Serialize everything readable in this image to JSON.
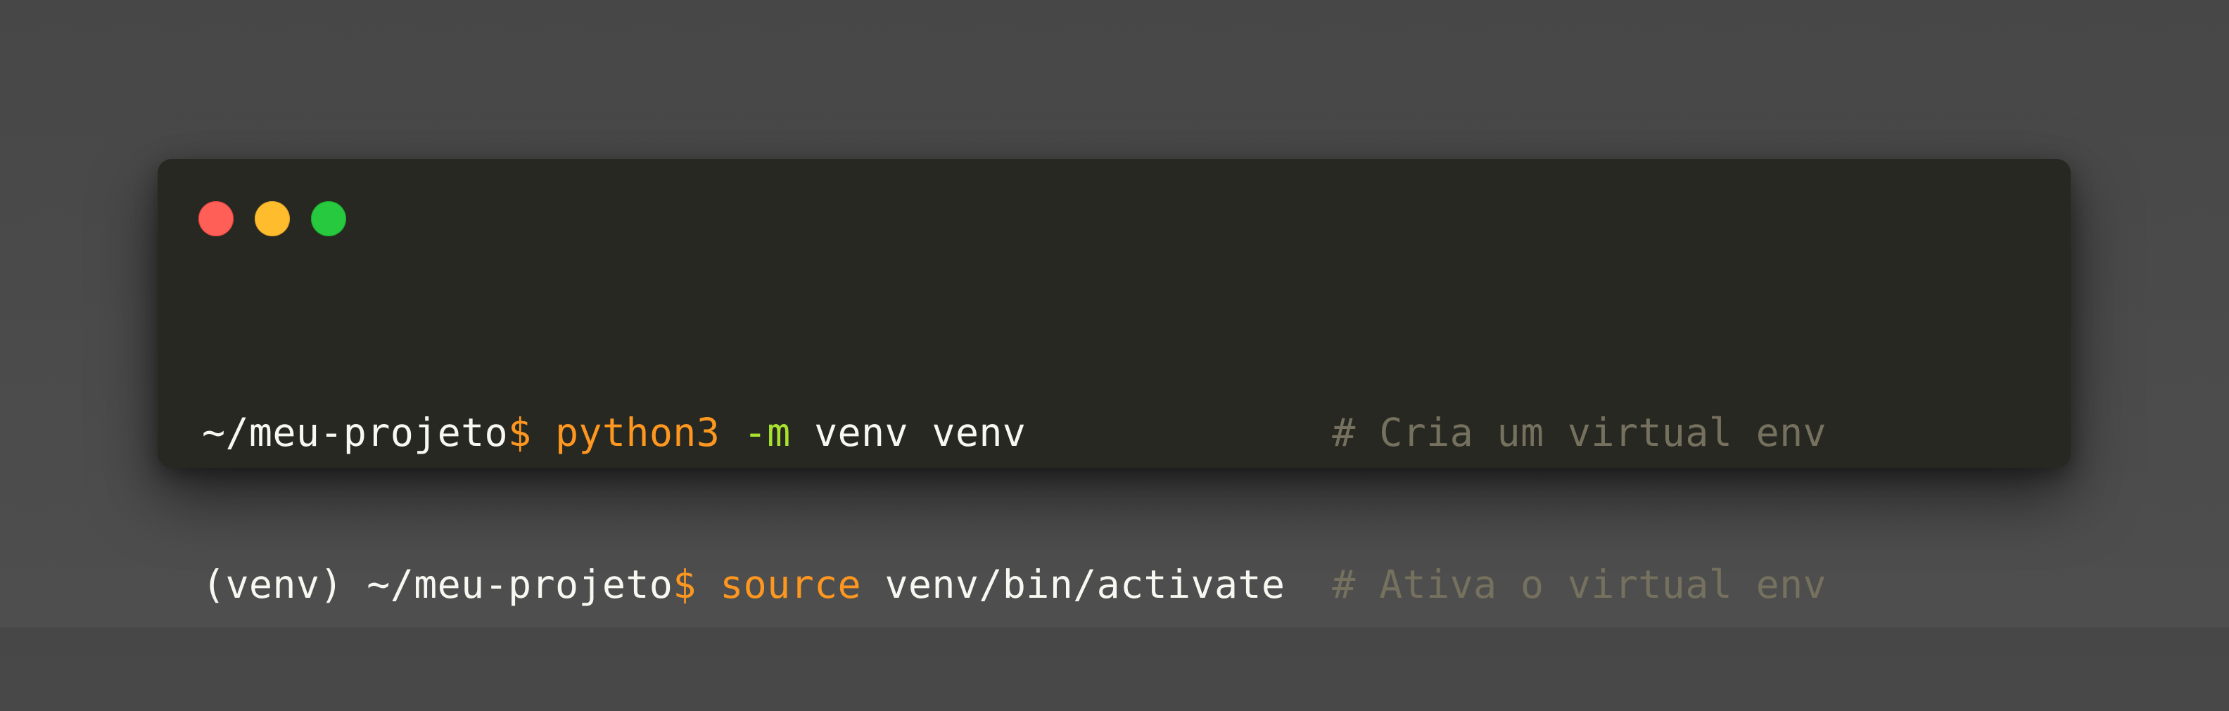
{
  "window": {
    "controls": [
      {
        "name": "close",
        "color": "#ff5f56"
      },
      {
        "name": "minimize",
        "color": "#ffbd2e"
      },
      {
        "name": "maximize",
        "color": "#27c93f"
      }
    ]
  },
  "colors": {
    "background": "#4a4a4a",
    "terminal": "#272822",
    "text": "#f8f8f2",
    "prompt_symbol": "#fd971f",
    "command": "#fd971f",
    "flag": "#a6e22e",
    "comment": "#75715e"
  },
  "lines": [
    {
      "env": "",
      "path": "~/meu-projeto",
      "prompt": "$",
      "command": "python3",
      "flag": "-m",
      "args": "venv venv",
      "comment": "# Cria um virtual env"
    },
    {
      "env": "(venv) ",
      "path": "~/meu-projeto",
      "prompt": "$",
      "command": "source",
      "flag": "",
      "args": "venv/bin/activate",
      "comment": "# Ativa o virtual env"
    }
  ]
}
